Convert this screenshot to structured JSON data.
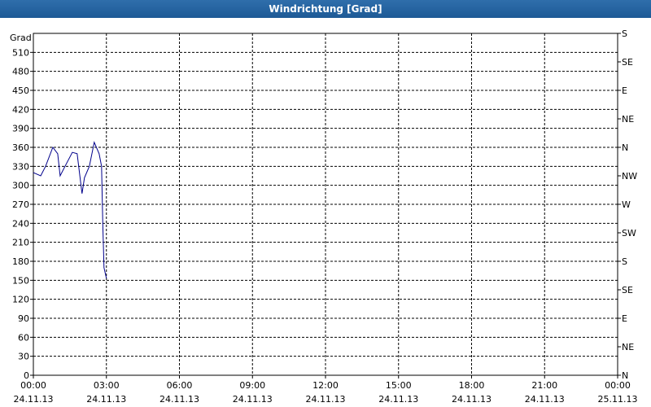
{
  "window": {
    "title": "Windrichtung [Grad]"
  },
  "chart_data": {
    "type": "line",
    "title": "Windrichtung [Grad]",
    "ylabel": "Grad",
    "ylim": [
      0,
      540
    ],
    "yticks": [
      0,
      30,
      60,
      90,
      120,
      150,
      180,
      210,
      240,
      270,
      300,
      330,
      360,
      390,
      420,
      450,
      480,
      510
    ],
    "right_axis_labels": [
      "N",
      "NE",
      "E",
      "SE",
      "S",
      "SW",
      "W",
      "NW",
      "N",
      "NE",
      "E",
      "SE",
      "S"
    ],
    "xlim_hours": [
      0,
      24
    ],
    "xticks": [
      {
        "time": "00:00",
        "date": "24.11.13"
      },
      {
        "time": "03:00",
        "date": "24.11.13"
      },
      {
        "time": "06:00",
        "date": "24.11.13"
      },
      {
        "time": "09:00",
        "date": "24.11.13"
      },
      {
        "time": "12:00",
        "date": "24.11.13"
      },
      {
        "time": "15:00",
        "date": "24.11.13"
      },
      {
        "time": "18:00",
        "date": "24.11.13"
      },
      {
        "time": "21:00",
        "date": "24.11.13"
      },
      {
        "time": "00:00",
        "date": "25.11.13"
      }
    ],
    "grid": true,
    "line_color": "#00008b",
    "series": [
      {
        "hours": [
          0.0,
          0.3,
          0.5,
          0.8,
          1.0,
          1.1,
          1.3,
          1.6,
          1.8,
          2.0,
          2.1,
          2.3,
          2.5,
          2.7,
          2.8,
          2.85,
          2.9,
          3.0
        ],
        "values": [
          320,
          315,
          330,
          360,
          350,
          315,
          330,
          352,
          350,
          287,
          312,
          330,
          368,
          350,
          330,
          240,
          170,
          153
        ]
      }
    ]
  }
}
